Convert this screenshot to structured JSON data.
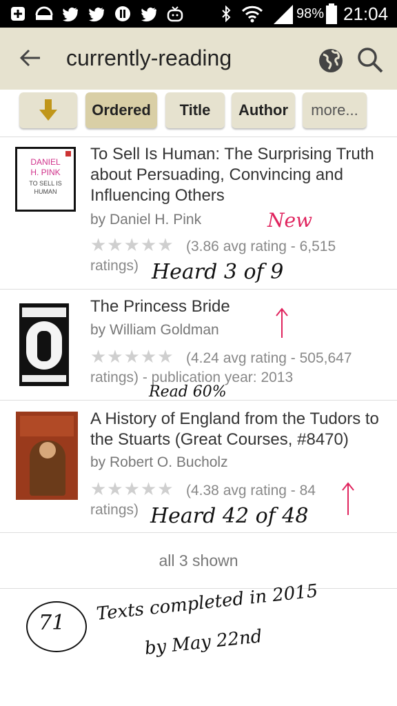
{
  "status_bar": {
    "battery": "98%",
    "time": "21:04",
    "icons": [
      "plus-box-icon",
      "router-icon",
      "twitter-icon",
      "twitter-icon",
      "pause-circle-icon",
      "twitter-icon",
      "tv-icon",
      "bluetooth-icon",
      "wifi-icon",
      "signal-icon",
      "battery-icon"
    ]
  },
  "toolbar": {
    "title": "currently-reading",
    "back_icon": "back-arrow-icon",
    "globe_icon": "globe-icon",
    "search_icon": "search-icon"
  },
  "sort": {
    "download_icon": "download-arrow-icon",
    "buttons": [
      "Ordered",
      "Title",
      "Author",
      "more..."
    ],
    "active": "Ordered"
  },
  "books": [
    {
      "title": "To Sell Is Human: The Surprising Truth about Persuading, Convincing and Influencing Others",
      "author": "by Daniel H. Pink",
      "stars_rating": 3.86,
      "rating_line1": "(3.86 avg rating - 6,515",
      "rating_line2": "ratings)",
      "cover_text": [
        "DANIEL",
        "H. PINK",
        "TO SELL IS",
        "HUMAN"
      ],
      "note": "Heard 3 of 9",
      "note_red": "New"
    },
    {
      "title": "The Princess Bride",
      "author": "by William Goldman",
      "stars_rating": 4.24,
      "rating_line1": "(4.24 avg rating - 505,647",
      "rating_line2": "ratings) - publication year: 2013",
      "note": "Read 60%"
    },
    {
      "title": "A History of England from the Tudors to the Stuarts (Great Courses, #8470)",
      "author": "by Robert O. Bucholz",
      "stars_rating": 4.38,
      "rating_line1": "(4.38 avg rating - 84",
      "rating_line2": "ratings)",
      "note": "Heard 42 of 48"
    }
  ],
  "footer": {
    "count_text": "all 3 shown"
  },
  "handwritten": {
    "circled_number": "71",
    "line1": "Texts completed in 2015",
    "line2": "by May 22nd"
  },
  "colors": {
    "toolbar": "#e6e2cf",
    "button": "#e6e2cf",
    "button_active": "#d9cfa6",
    "download_arrow": "#c0961a",
    "note_red": "#e0245e"
  }
}
